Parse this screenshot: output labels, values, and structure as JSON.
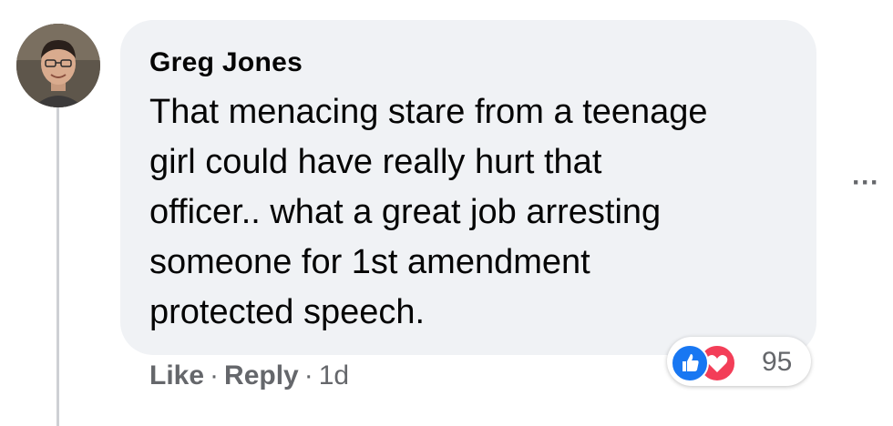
{
  "comment": {
    "author": "Greg Jones",
    "text": "That menacing stare from a teenage\ngirl could have really hurt that\nofficer.. what a great job arresting\nsomeone for 1st amendment\nprotected speech.",
    "more_icon": "more-options-icon"
  },
  "reactions": {
    "icons": [
      "like-icon",
      "love-icon"
    ],
    "count": "95"
  },
  "actions": {
    "like_label": "Like",
    "separator": "·",
    "reply_label": "Reply",
    "timestamp": "1d"
  },
  "colors": {
    "bubble_bg": "#f0f2f5",
    "text": "#050505",
    "secondary_text": "#65676b",
    "like_blue": "#1877f2",
    "love_red": "#f33e58"
  }
}
